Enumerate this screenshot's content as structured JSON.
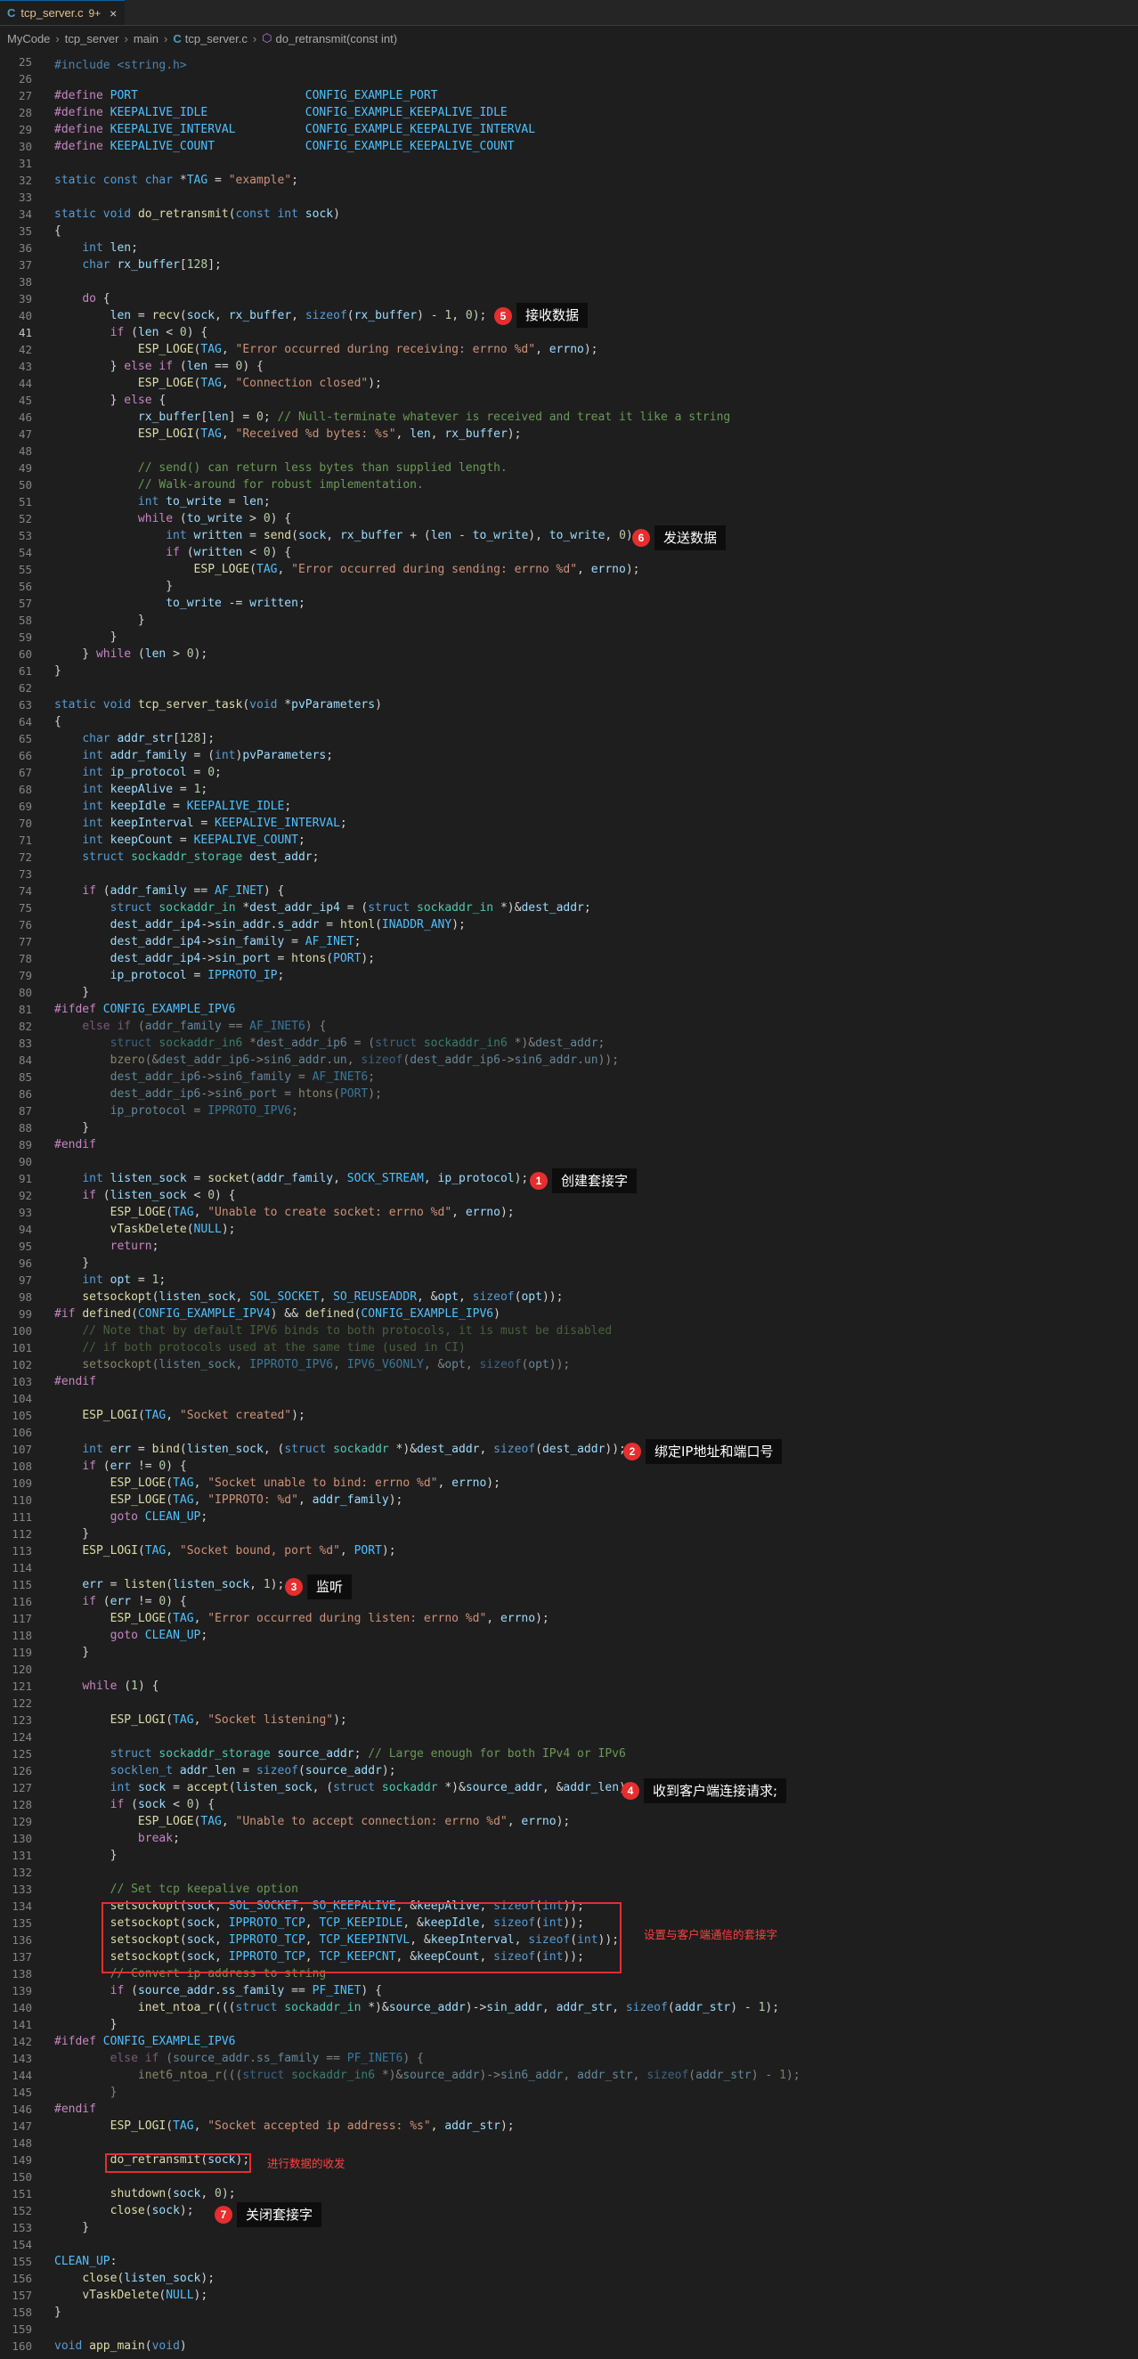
{
  "tab": {
    "icon": "C",
    "filename": "tcp_server.c",
    "badge": "9+",
    "close": "×"
  },
  "breadcrumb": {
    "items": [
      "MyCode",
      "tcp_server",
      "main",
      "tcp_server.c",
      "do_retransmit(const int)"
    ],
    "file_icon": "C"
  },
  "annotations": {
    "a1": {
      "num": "1",
      "text": "创建套接字"
    },
    "a2": {
      "num": "2",
      "text": "绑定IP地址和端口号"
    },
    "a3": {
      "num": "3",
      "text": "监听"
    },
    "a4": {
      "num": "4",
      "text": "收到客户端连接请求;"
    },
    "a5": {
      "num": "5",
      "text": "接收数据"
    },
    "a6": {
      "num": "6",
      "text": "发送数据"
    },
    "a7": {
      "num": "7",
      "text": "关闭套接字"
    },
    "box1": "设置与客户端通信的套接字",
    "box2": "进行数据的收发"
  },
  "code": {
    "first_line": 25,
    "active_line": 41,
    "lines": [
      "",
      "",
      "#define PORT                        CONFIG_EXAMPLE_PORT",
      "#define KEEPALIVE_IDLE              CONFIG_EXAMPLE_KEEPALIVE_IDLE",
      "#define KEEPALIVE_INTERVAL          CONFIG_EXAMPLE_KEEPALIVE_INTERVAL",
      "#define KEEPALIVE_COUNT             CONFIG_EXAMPLE_KEEPALIVE_COUNT",
      "",
      "static const char *TAG = \"example\";",
      "",
      "static void do_retransmit(const int sock)",
      "{",
      "    int len;",
      "    char rx_buffer[128];",
      "",
      "    do {",
      "        len = recv(sock, rx_buffer, sizeof(rx_buffer) - 1, 0);",
      "        if (len < 0) {",
      "            ESP_LOGE(TAG, \"Error occurred during receiving: errno %d\", errno);",
      "        } else if (len == 0) {",
      "            ESP_LOGE(TAG, \"Connection closed\");",
      "        } else {",
      "            rx_buffer[len] = 0; // Null-terminate whatever is received and treat it like a string",
      "            ESP_LOGI(TAG, \"Received %d bytes: %s\", len, rx_buffer);",
      "",
      "            // send() can return less bytes than supplied length.",
      "            // Walk-around for robust implementation.",
      "            int to_write = len;",
      "            while (to_write > 0) {",
      "                int written = send(sock, rx_buffer + (len - to_write), to_write, 0);",
      "                if (written < 0) {",
      "                    ESP_LOGE(TAG, \"Error occurred during sending: errno %d\", errno);",
      "                }",
      "                to_write -= written;",
      "            }",
      "        }",
      "    } while (len > 0);",
      "}",
      "",
      "static void tcp_server_task(void *pvParameters)",
      "{",
      "    char addr_str[128];",
      "    int addr_family = (int)pvParameters;",
      "    int ip_protocol = 0;",
      "    int keepAlive = 1;",
      "    int keepIdle = KEEPALIVE_IDLE;",
      "    int keepInterval = KEEPALIVE_INTERVAL;",
      "    int keepCount = KEEPALIVE_COUNT;",
      "    struct sockaddr_storage dest_addr;",
      "",
      "    if (addr_family == AF_INET) {",
      "        struct sockaddr_in *dest_addr_ip4 = (struct sockaddr_in *)&dest_addr;",
      "        dest_addr_ip4->sin_addr.s_addr = htonl(INADDR_ANY);",
      "        dest_addr_ip4->sin_family = AF_INET;",
      "        dest_addr_ip4->sin_port = htons(PORT);",
      "        ip_protocol = IPPROTO_IP;",
      "    }",
      "#ifdef CONFIG_EXAMPLE_IPV6",
      "    else if (addr_family == AF_INET6) {",
      "        struct sockaddr_in6 *dest_addr_ip6 = (struct sockaddr_in6 *)&dest_addr;",
      "        bzero(&dest_addr_ip6->sin6_addr.un, sizeof(dest_addr_ip6->sin6_addr.un));",
      "        dest_addr_ip6->sin6_family = AF_INET6;",
      "        dest_addr_ip6->sin6_port = htons(PORT);",
      "        ip_protocol = IPPROTO_IPV6;",
      "    }",
      "#endif",
      "",
      "    int listen_sock = socket(addr_family, SOCK_STREAM, ip_protocol);",
      "    if (listen_sock < 0) {",
      "        ESP_LOGE(TAG, \"Unable to create socket: errno %d\", errno);",
      "        vTaskDelete(NULL);",
      "        return;",
      "    }",
      "    int opt = 1;",
      "    setsockopt(listen_sock, SOL_SOCKET, SO_REUSEADDR, &opt, sizeof(opt));",
      "#if defined(CONFIG_EXAMPLE_IPV4) && defined(CONFIG_EXAMPLE_IPV6)",
      "    // Note that by default IPV6 binds to both protocols, it is must be disabled",
      "    // if both protocols used at the same time (used in CI)",
      "    setsockopt(listen_sock, IPPROTO_IPV6, IPV6_V6ONLY, &opt, sizeof(opt));",
      "#endif",
      "",
      "    ESP_LOGI(TAG, \"Socket created\");",
      "",
      "    int err = bind(listen_sock, (struct sockaddr *)&dest_addr, sizeof(dest_addr));",
      "    if (err != 0) {",
      "        ESP_LOGE(TAG, \"Socket unable to bind: errno %d\", errno);",
      "        ESP_LOGE(TAG, \"IPPROTO: %d\", addr_family);",
      "        goto CLEAN_UP;",
      "    }",
      "    ESP_LOGI(TAG, \"Socket bound, port %d\", PORT);",
      "",
      "    err = listen(listen_sock, 1);",
      "    if (err != 0) {",
      "        ESP_LOGE(TAG, \"Error occurred during listen: errno %d\", errno);",
      "        goto CLEAN_UP;",
      "    }",
      "",
      "    while (1) {",
      "",
      "        ESP_LOGI(TAG, \"Socket listening\");",
      "",
      "        struct sockaddr_storage source_addr; // Large enough for both IPv4 or IPv6",
      "        socklen_t addr_len = sizeof(source_addr);",
      "        int sock = accept(listen_sock, (struct sockaddr *)&source_addr, &addr_len);",
      "        if (sock < 0) {",
      "            ESP_LOGE(TAG, \"Unable to accept connection: errno %d\", errno);",
      "            break;",
      "        }",
      "",
      "        // Set tcp keepalive option",
      "        setsockopt(sock, SOL_SOCKET, SO_KEEPALIVE, &keepAlive, sizeof(int));",
      "        setsockopt(sock, IPPROTO_TCP, TCP_KEEPIDLE, &keepIdle, sizeof(int));",
      "        setsockopt(sock, IPPROTO_TCP, TCP_KEEPINTVL, &keepInterval, sizeof(int));",
      "        setsockopt(sock, IPPROTO_TCP, TCP_KEEPCNT, &keepCount, sizeof(int));",
      "        // Convert ip address to string",
      "        if (source_addr.ss_family == PF_INET) {",
      "            inet_ntoa_r(((struct sockaddr_in *)&source_addr)->sin_addr, addr_str, sizeof(addr_str) - 1);",
      "        }",
      "#ifdef CONFIG_EXAMPLE_IPV6",
      "        else if (source_addr.ss_family == PF_INET6) {",
      "            inet6_ntoa_r(((struct sockaddr_in6 *)&source_addr)->sin6_addr, addr_str, sizeof(addr_str) - 1);",
      "        }",
      "#endif",
      "        ESP_LOGI(TAG, \"Socket accepted ip address: %s\", addr_str);",
      "",
      "        do_retransmit(sock);",
      "",
      "        shutdown(sock, 0);",
      "        close(sock);",
      "    }",
      "",
      "CLEAN_UP:",
      "    close(listen_sock);",
      "    vTaskDelete(NULL);",
      "}",
      "",
      "void app_main(void)"
    ]
  }
}
